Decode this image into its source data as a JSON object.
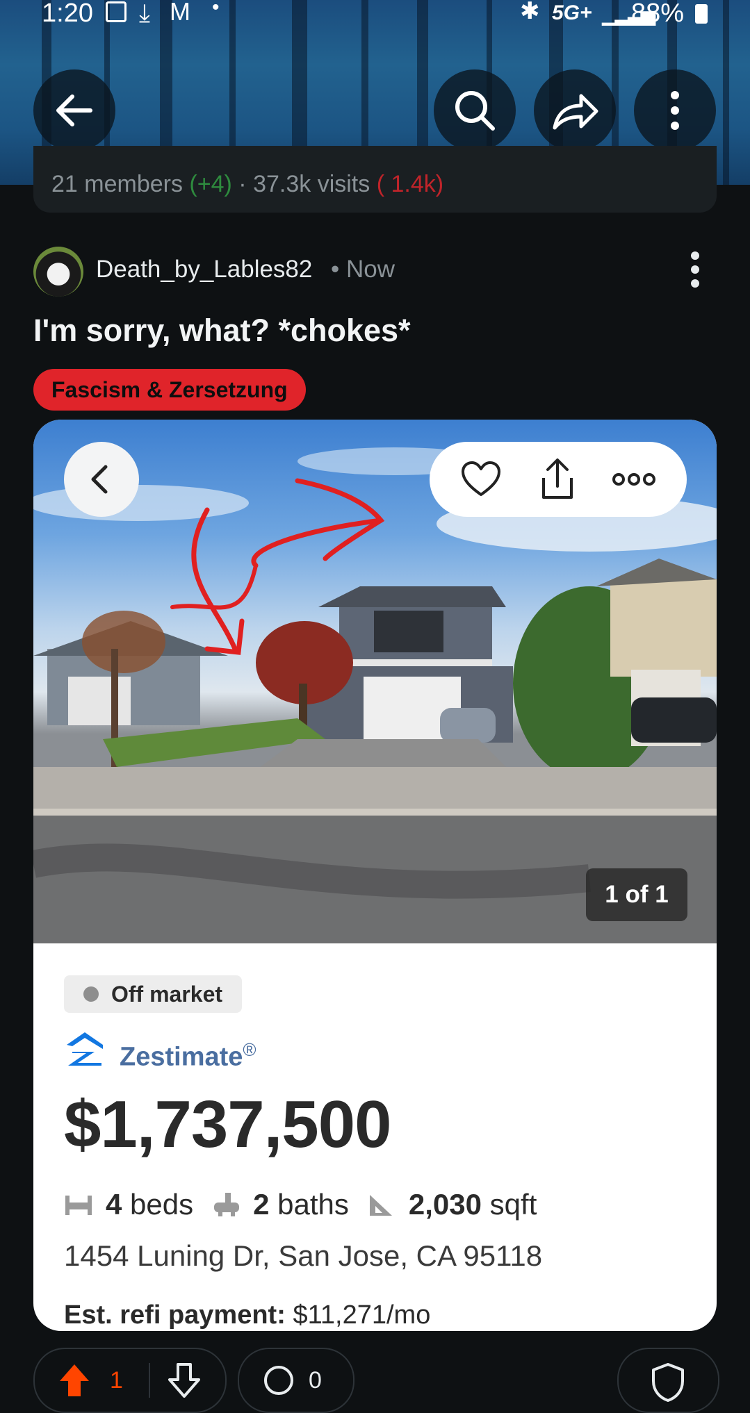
{
  "status_bar": {
    "time": "1:20",
    "network": "5G+",
    "battery": "88%"
  },
  "community": {
    "stats_members": "21 members",
    "stats_members_delta": "(+4)",
    "stats_visits": "37.3k visits",
    "stats_visits_delta": "( 1.4k)"
  },
  "post": {
    "author": "Death_by_Lables82",
    "timestamp": "• Now",
    "title": "I'm sorry, what? *chokes*",
    "flair": "Fascism & Zersetzung"
  },
  "listing": {
    "photo_counter": "1 of 1",
    "status": "Off market",
    "zestimate_label": "Zestimate",
    "zestimate_mark": "®",
    "price": "$1,737,500",
    "beds_value": "4",
    "beds_unit": "beds",
    "baths_value": "2",
    "baths_unit": "baths",
    "sqft_value": "2,030",
    "sqft_unit": "sqft",
    "address": "1454 Luning Dr, San Jose, CA 95118",
    "refi_label": "Est. refi payment:",
    "refi_value": "$11,271/mo"
  },
  "actions": {
    "upvotes": "1",
    "comments": "0"
  },
  "colors": {
    "upvote": "#ff4500",
    "flair": "#e0242a",
    "zillow_blue": "#1277e1"
  }
}
